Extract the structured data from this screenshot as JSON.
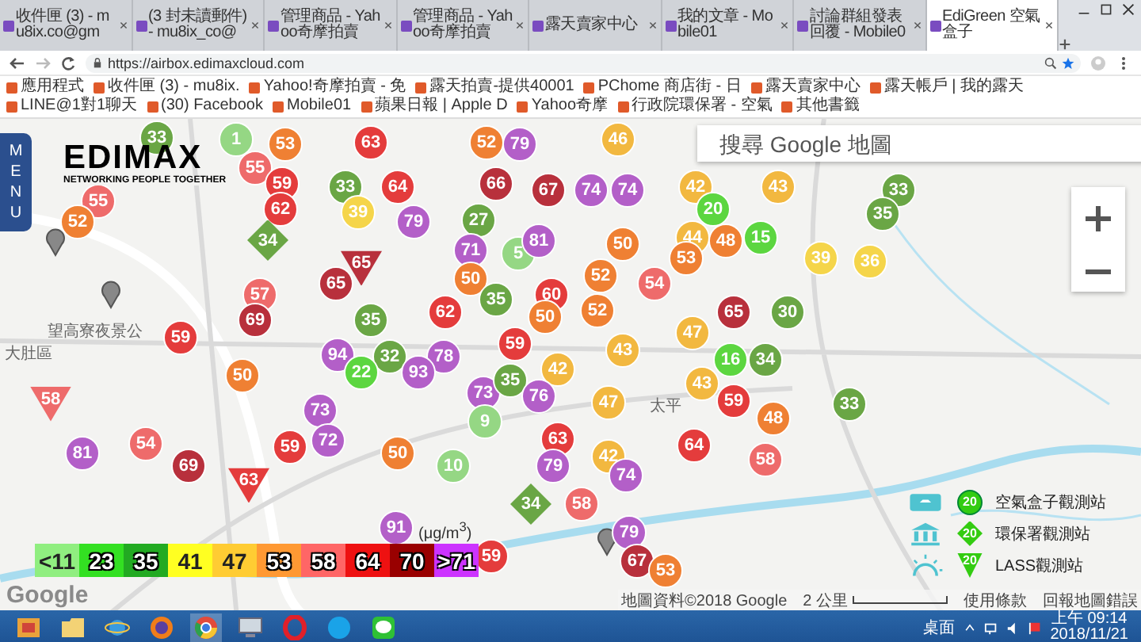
{
  "browser": {
    "tabs": [
      {
        "title": "收件匣 (3) - mu8ix.co@gm",
        "selected": false
      },
      {
        "title": "(3 封未讀郵件) - mu8ix_co@",
        "selected": false
      },
      {
        "title": "管理商品 - Yahoo奇摩拍賣",
        "selected": false
      },
      {
        "title": "管理商品 - Yahoo奇摩拍賣",
        "selected": false
      },
      {
        "title": "露天賣家中心",
        "selected": false
      },
      {
        "title": "我的文章 - Mobile01",
        "selected": false
      },
      {
        "title": "討論群組發表回覆 - Mobile0",
        "selected": false
      },
      {
        "title": "EdiGreen 空氣盒子",
        "selected": true
      }
    ],
    "address": "https://airbox.edimaxcloud.com",
    "bookmarks": [
      "應用程式",
      "收件匣 (3) - mu8ix.",
      "Yahoo!奇摩拍賣 - 免",
      "露天拍賣-提供40001",
      "PChome 商店街 - 日",
      "露天賣家中心",
      "露天帳戶 | 我的露天",
      "LINE@1對1聊天",
      "(30) Facebook",
      "Mobile01",
      "蘋果日報 | Apple D",
      "Yahoo奇摩",
      "行政院環保署 - 空氣",
      "其他書籤"
    ]
  },
  "map": {
    "menu": "MENU",
    "logo": {
      "name": "EDIMAX",
      "tagline": "NETWORKING PEOPLE TOGETHER"
    },
    "search": {
      "placeholder": "搜尋 Google 地圖"
    },
    "labels": [
      "望高寮夜景公",
      "大肚區",
      "太平"
    ],
    "markers": [
      {
        "value": "33",
        "color": "#6aa645",
        "kind": "circle"
      },
      {
        "value": "1",
        "color": "#95d784",
        "kind": "circle"
      },
      {
        "value": "53",
        "color": "#ef8033",
        "kind": "circle"
      },
      {
        "value": "63",
        "color": "#e43c3c",
        "kind": "circle"
      },
      {
        "value": "52",
        "color": "#ef8033",
        "kind": "circle"
      },
      {
        "value": "79",
        "color": "#b35fc8",
        "kind": "circle"
      },
      {
        "value": "46",
        "color": "#f2b840",
        "kind": "circle"
      },
      {
        "value": "55",
        "color": "#ee6b6b",
        "kind": "circle"
      },
      {
        "value": "55",
        "color": "#ee6b6b",
        "kind": "circle"
      },
      {
        "value": "59",
        "color": "#e43c3c",
        "kind": "circle"
      },
      {
        "value": "33",
        "color": "#6aa645",
        "kind": "circle"
      },
      {
        "value": "64",
        "color": "#e43c3c",
        "kind": "circle"
      },
      {
        "value": "66",
        "color": "#b8303c",
        "kind": "circle"
      },
      {
        "value": "67",
        "color": "#b8303c",
        "kind": "circle"
      },
      {
        "value": "74",
        "color": "#b35fc8",
        "kind": "circle"
      },
      {
        "value": "74",
        "color": "#b35fc8",
        "kind": "circle"
      },
      {
        "value": "42",
        "color": "#f2b840",
        "kind": "circle"
      },
      {
        "value": "43",
        "color": "#f2b840",
        "kind": "circle"
      },
      {
        "value": "33",
        "color": "#6aa645",
        "kind": "circle"
      },
      {
        "value": "52",
        "color": "#ef8033",
        "kind": "circle"
      },
      {
        "value": "62",
        "color": "#e43c3c",
        "kind": "circle"
      },
      {
        "value": "39",
        "color": "#f5d54a",
        "kind": "circle"
      },
      {
        "value": "79",
        "color": "#b35fc8",
        "kind": "circle"
      },
      {
        "value": "27",
        "color": "#6aa645",
        "kind": "circle"
      },
      {
        "value": "20",
        "color": "#5cd640",
        "kind": "circle"
      },
      {
        "value": "35",
        "color": "#6aa645",
        "kind": "circle"
      },
      {
        "value": "34",
        "color": "#6aa645",
        "kind": "diamond"
      },
      {
        "value": "71",
        "color": "#b35fc8",
        "kind": "circle"
      },
      {
        "value": "5",
        "color": "#95d784",
        "kind": "circle"
      },
      {
        "value": "81",
        "color": "#b35fc8",
        "kind": "circle"
      },
      {
        "value": "50",
        "color": "#ef8033",
        "kind": "circle"
      },
      {
        "value": "44",
        "color": "#f2b840",
        "kind": "circle"
      },
      {
        "value": "53",
        "color": "#ef8033",
        "kind": "circle"
      },
      {
        "value": "48",
        "color": "#ef8033",
        "kind": "circle"
      },
      {
        "value": "15",
        "color": "#5cd640",
        "kind": "circle"
      },
      {
        "value": "39",
        "color": "#f5d54a",
        "kind": "circle"
      },
      {
        "value": "65",
        "color": "#b8303c",
        "kind": "circle"
      },
      {
        "value": "65",
        "color": "#b8303c",
        "kind": "triangle"
      },
      {
        "value": "50",
        "color": "#ef8033",
        "kind": "circle"
      },
      {
        "value": "52",
        "color": "#ef8033",
        "kind": "circle"
      },
      {
        "value": "54",
        "color": "#ee6b6b",
        "kind": "circle"
      },
      {
        "value": "36",
        "color": "#f5d54a",
        "kind": "circle"
      },
      {
        "value": "57",
        "color": "#ee6b6b",
        "kind": "circle"
      },
      {
        "value": "62",
        "color": "#e43c3c",
        "kind": "circle"
      },
      {
        "value": "35",
        "color": "#6aa645",
        "kind": "circle"
      },
      {
        "value": "60",
        "color": "#e43c3c",
        "kind": "circle"
      },
      {
        "value": "52",
        "color": "#ef8033",
        "kind": "circle"
      },
      {
        "value": "65",
        "color": "#b8303c",
        "kind": "circle"
      },
      {
        "value": "30",
        "color": "#6aa645",
        "kind": "circle"
      },
      {
        "value": "59",
        "color": "#e43c3c",
        "kind": "circle"
      },
      {
        "value": "69",
        "color": "#b8303c",
        "kind": "circle"
      },
      {
        "value": "35",
        "color": "#6aa645",
        "kind": "circle"
      },
      {
        "value": "50",
        "color": "#ef8033",
        "kind": "circle"
      },
      {
        "value": "47",
        "color": "#f2b840",
        "kind": "circle"
      },
      {
        "value": "94",
        "color": "#b35fc8",
        "kind": "circle"
      },
      {
        "value": "32",
        "color": "#6aa645",
        "kind": "circle"
      },
      {
        "value": "78",
        "color": "#b35fc8",
        "kind": "circle"
      },
      {
        "value": "59",
        "color": "#e43c3c",
        "kind": "circle"
      },
      {
        "value": "42",
        "color": "#f2b840",
        "kind": "circle"
      },
      {
        "value": "43",
        "color": "#f2b840",
        "kind": "circle"
      },
      {
        "value": "16",
        "color": "#5cd640",
        "kind": "circle"
      },
      {
        "value": "34",
        "color": "#6aa645",
        "kind": "circle"
      },
      {
        "value": "50",
        "color": "#ef8033",
        "kind": "circle"
      },
      {
        "value": "22",
        "color": "#5cd640",
        "kind": "circle"
      },
      {
        "value": "93",
        "color": "#b35fc8",
        "kind": "circle"
      },
      {
        "value": "73",
        "color": "#b35fc8",
        "kind": "circle"
      },
      {
        "value": "35",
        "color": "#6aa645",
        "kind": "circle"
      },
      {
        "value": "76",
        "color": "#b35fc8",
        "kind": "circle"
      },
      {
        "value": "43",
        "color": "#f2b840",
        "kind": "circle"
      },
      {
        "value": "58",
        "color": "#ee6b6b",
        "kind": "triangle"
      },
      {
        "value": "73",
        "color": "#b35fc8",
        "kind": "circle"
      },
      {
        "value": "9",
        "color": "#95d784",
        "kind": "circle"
      },
      {
        "value": "47",
        "color": "#f2b840",
        "kind": "circle"
      },
      {
        "value": "59",
        "color": "#e43c3c",
        "kind": "circle"
      },
      {
        "value": "48",
        "color": "#ef8033",
        "kind": "circle"
      },
      {
        "value": "33",
        "color": "#6aa645",
        "kind": "circle"
      },
      {
        "value": "81",
        "color": "#b35fc8",
        "kind": "circle"
      },
      {
        "value": "54",
        "color": "#ee6b6b",
        "kind": "circle"
      },
      {
        "value": "59",
        "color": "#e43c3c",
        "kind": "circle"
      },
      {
        "value": "72",
        "color": "#b35fc8",
        "kind": "circle"
      },
      {
        "value": "50",
        "color": "#ef8033",
        "kind": "circle"
      },
      {
        "value": "63",
        "color": "#e43c3c",
        "kind": "circle"
      },
      {
        "value": "42",
        "color": "#f2b840",
        "kind": "circle"
      },
      {
        "value": "64",
        "color": "#e43c3c",
        "kind": "circle"
      },
      {
        "value": "69",
        "color": "#b8303c",
        "kind": "circle"
      },
      {
        "value": "10",
        "color": "#95d784",
        "kind": "circle"
      },
      {
        "value": "79",
        "color": "#b35fc8",
        "kind": "circle"
      },
      {
        "value": "74",
        "color": "#b35fc8",
        "kind": "circle"
      },
      {
        "value": "58",
        "color": "#ee6b6b",
        "kind": "circle"
      },
      {
        "value": "63",
        "color": "#e43c3c",
        "kind": "triangle"
      },
      {
        "value": "34",
        "color": "#6aa645",
        "kind": "diamond"
      },
      {
        "value": "58",
        "color": "#ee6b6b",
        "kind": "circle"
      },
      {
        "value": "91",
        "color": "#b35fc8",
        "kind": "circle"
      },
      {
        "value": "79",
        "color": "#b35fc8",
        "kind": "circle"
      },
      {
        "value": "59",
        "color": "#e43c3c",
        "kind": "circle"
      },
      {
        "value": "67",
        "color": "#b8303c",
        "kind": "circle"
      },
      {
        "value": "53",
        "color": "#ef8033",
        "kind": "circle"
      }
    ],
    "unit": "(μg/m$^{3}$)",
    "legend": [
      {
        "label": "<11",
        "color": "#90ee80"
      },
      {
        "label": "23",
        "color": "#33e022"
      },
      {
        "label": "35",
        "color": "#22aa22"
      },
      {
        "label": "41",
        "color": "#ffff22"
      },
      {
        "label": "47",
        "color": "#ffcc33"
      },
      {
        "label": "53",
        "color": "#ff9933"
      },
      {
        "label": "58",
        "color": "#ff6666"
      },
      {
        "label": "64",
        "color": "#ee1111"
      },
      {
        "label": "70",
        "color": "#990000"
      },
      {
        "label": ">71",
        "color": "#cc33ff"
      }
    ],
    "stations": [
      {
        "kind": "airbox",
        "sample": "20",
        "label": "空氣盒子觀測站"
      },
      {
        "kind": "epa",
        "sample": "20",
        "label": "環保署觀測站"
      },
      {
        "kind": "lass",
        "sample": "20",
        "label": "LASS觀測站"
      }
    ],
    "google_logo": "Google",
    "footer": {
      "attribution": "地圖資料©2018 Google",
      "scale": "2 公里",
      "terms": "使用條款",
      "report": "回報地圖錯誤"
    }
  },
  "taskbar": {
    "desktop": "桌面",
    "time": "上午 09:14",
    "date": "2018/11/21"
  }
}
